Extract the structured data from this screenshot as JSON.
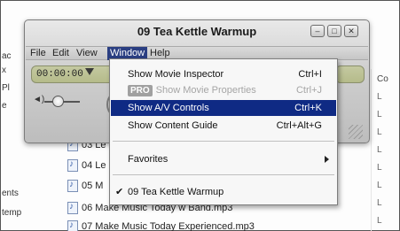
{
  "player": {
    "title": "09 Tea Kettle Warmup",
    "window_buttons": [
      "minimize",
      "maximize",
      "close"
    ],
    "menubar": [
      "File",
      "Edit",
      "View",
      "Window",
      "Help"
    ],
    "active_menu": "Window",
    "timecode": "00:00:00"
  },
  "window_menu": {
    "items": [
      {
        "label": "Show Movie Inspector",
        "shortcut": "Ctrl+I"
      },
      {
        "badge": "PRO",
        "label": "Show Movie Properties",
        "shortcut": "Ctrl+J",
        "disabled": true
      },
      {
        "label": "Show A/V Controls",
        "shortcut": "Ctrl+K",
        "highlighted": true
      },
      {
        "label": "Show Content Guide",
        "shortcut": "Ctrl+Alt+G"
      },
      {
        "label": "Favorites",
        "submenu": true
      },
      {
        "label": "09 Tea Kettle Warmup",
        "checked": true
      }
    ],
    "check_glyph": "✔"
  },
  "files": [
    {
      "name": "03 Le"
    },
    {
      "name": "04 Le"
    },
    {
      "name": "05 M"
    },
    {
      "name": "06 Make Music Today w Band.mp3"
    },
    {
      "name": "07 Make Music Today Experienced.mp3"
    }
  ],
  "left_fragments": [
    "ac",
    "x",
    "Pl",
    "e",
    "ents",
    "temp"
  ],
  "right_column": {
    "header": "Co",
    "cells": [
      "L",
      "L",
      "L",
      "L",
      "L",
      "L",
      "L",
      "L",
      "L"
    ]
  },
  "colors": {
    "menu_highlight": "#0f2a84",
    "lcd": "#c4c9a1"
  }
}
